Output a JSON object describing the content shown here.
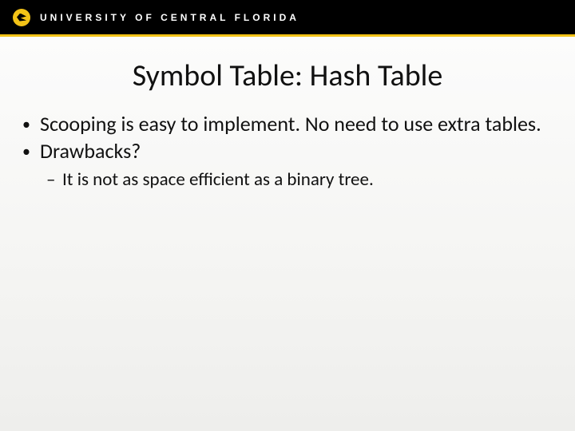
{
  "header": {
    "org_name": "UNIVERSITY OF CENTRAL FLORIDA"
  },
  "slide": {
    "title": "Symbol Table: Hash Table",
    "bullets": [
      {
        "text": "Scooping is easy to implement. No need to use extra tables."
      },
      {
        "text": "Drawbacks?"
      }
    ],
    "sub_bullets": [
      {
        "dash": "–",
        "text": "It is not as space efficient as a binary tree."
      }
    ]
  }
}
